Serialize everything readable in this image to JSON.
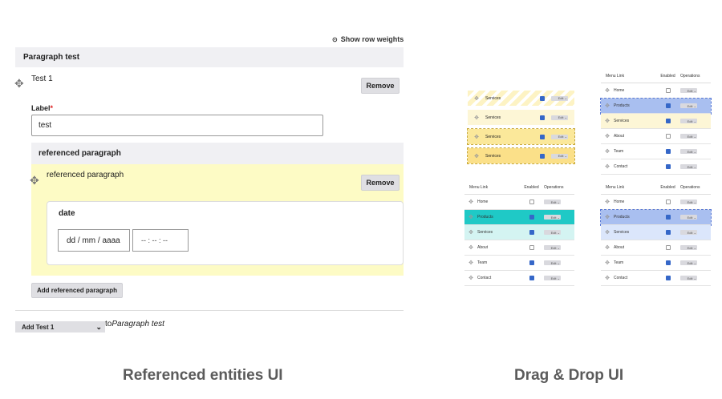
{
  "left": {
    "show_row_weights": "Show row weights",
    "paragraph_header": "Paragraph test",
    "item_title": "Test 1",
    "remove1": "Remove",
    "label_label": "Label",
    "label_value": "test",
    "ref_header": "referenced paragraph",
    "ref_item_title": "referenced paragraph",
    "remove2": "Remove",
    "date_label": "date",
    "date_value": "dd / mm / aaaa",
    "time_value": "-- : -- : --",
    "add_ref_button": "Add referenced paragraph",
    "add_select": "Add Test 1",
    "to_text": "to",
    "to_target": "Paragraph test",
    "caption": "Referenced entities UI"
  },
  "right": {
    "caption": "Drag & Drop UI",
    "headers": {
      "menu_link": "Menu Link",
      "enabled": "Enabled",
      "operations": "Operations"
    },
    "edit": "Edit",
    "yellow_rows": [
      "Services",
      "Services",
      "Services",
      "Services"
    ],
    "table_top_right": [
      "Home",
      "Products",
      "Services",
      "About",
      "Team",
      "Contact"
    ],
    "table_bottom_left": [
      "Home",
      "Products",
      "Services",
      "About",
      "Team",
      "Contact"
    ],
    "table_bottom_right": [
      "Home",
      "Products",
      "Services",
      "About",
      "Team",
      "Contact"
    ],
    "enabled_flags": [
      false,
      true,
      true,
      false,
      true,
      true
    ]
  }
}
